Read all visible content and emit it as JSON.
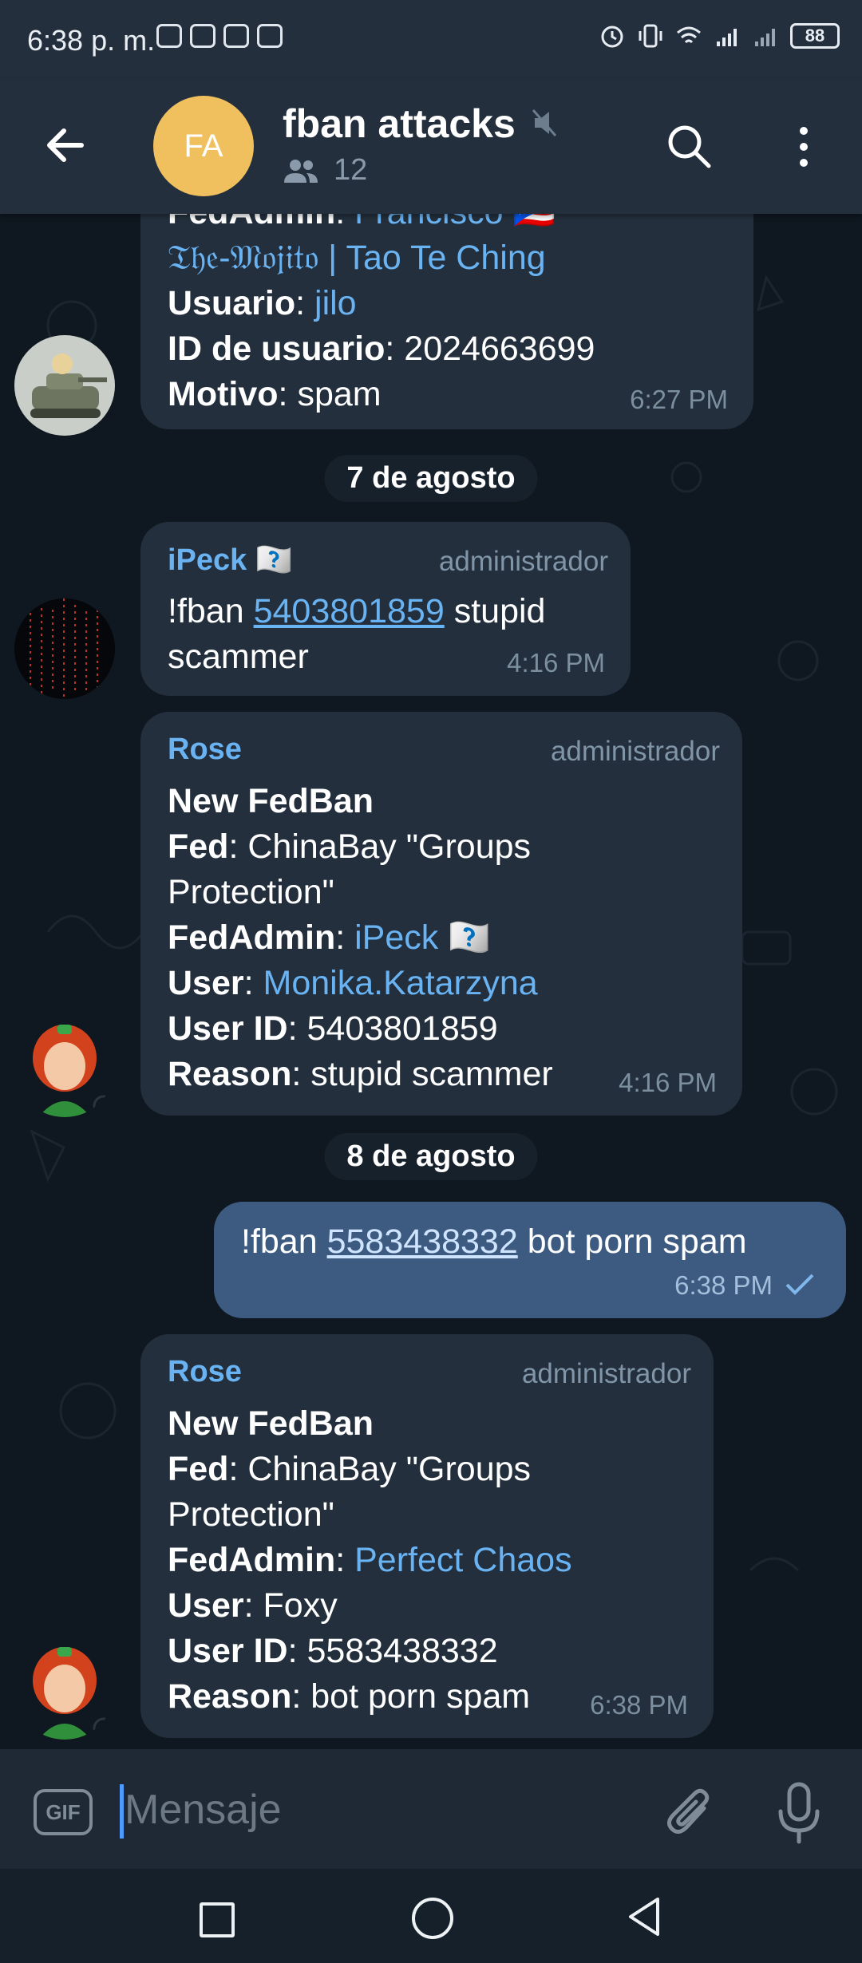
{
  "status_bar": {
    "time": "6:38 p. m.",
    "battery": "88",
    "left_icons": [
      "gmail-icon",
      "instagram-icon",
      "instagram-icon",
      "gallery-icon"
    ]
  },
  "header": {
    "avatar_initials": "FA",
    "title": "fban attacks",
    "member_count": "12"
  },
  "messages": [
    {
      "lines": [
        {
          "label": "FedAdmin",
          "value": "Francisco 🇵🇷"
        },
        {
          "label": "",
          "value": "𝔗𝔥𝔢-𝔐𝔬𝔧𝔦𝔱𝔬 | Tao Te Ching"
        },
        {
          "label": "Usuario",
          "value": "jilo"
        },
        {
          "label": "ID de usuario",
          "value": "2024663699"
        },
        {
          "label": "Motivo",
          "value": "spam"
        }
      ],
      "time": "6:27 PM"
    },
    {
      "sender": "iPeck 🇶🇨",
      "role": "administrador",
      "command": "!fban",
      "id_link": "5403801859",
      "text_tail": "stupid",
      "text_line2": "scammer",
      "time": "4:16 PM"
    },
    {
      "sender": "Rose",
      "role": "administrador",
      "heading": "New FedBan",
      "fed_label": "Fed",
      "fed_value": "ChinaBay \"Groups",
      "fed_value2": "Protection\"",
      "fedadmin_label": "FedAdmin",
      "fedadmin_value": "iPeck 🇶🇨",
      "user_label": "User",
      "user_value": "Monika.Katarzyna",
      "userid_label": "User ID",
      "userid_value": "5403801859",
      "reason_label": "Reason",
      "reason_value": "stupid scammer",
      "time": "4:16 PM"
    },
    {
      "outgoing": true,
      "command": "!fban",
      "id_link": "5583438332",
      "text_tail": "bot porn spam",
      "time": "6:38 PM"
    },
    {
      "sender": "Rose",
      "role": "administrador",
      "heading": "New FedBan",
      "fed_label": "Fed",
      "fed_value": "ChinaBay \"Groups",
      "fed_value2": "Protection\"",
      "fedadmin_label": "FedAdmin",
      "fedadmin_value": "Perfect Chaos",
      "user_label": "User",
      "user_value": "Foxy",
      "userid_label": "User ID",
      "userid_value": "5583438332",
      "reason_label": "Reason",
      "reason_value": "bot porn spam",
      "time": "6:38 PM"
    }
  ],
  "date_separators": [
    "7 de agosto",
    "8 de agosto"
  ],
  "composer": {
    "placeholder": "Mensaje",
    "gif_label": "GIF"
  },
  "colors": {
    "accent": "#6ab3f3",
    "header_bg": "#242f3d",
    "incoming_bubble": "#232f3c",
    "outgoing_bubble": "#3d5a80",
    "avatar_fa": "#f0c05e"
  }
}
